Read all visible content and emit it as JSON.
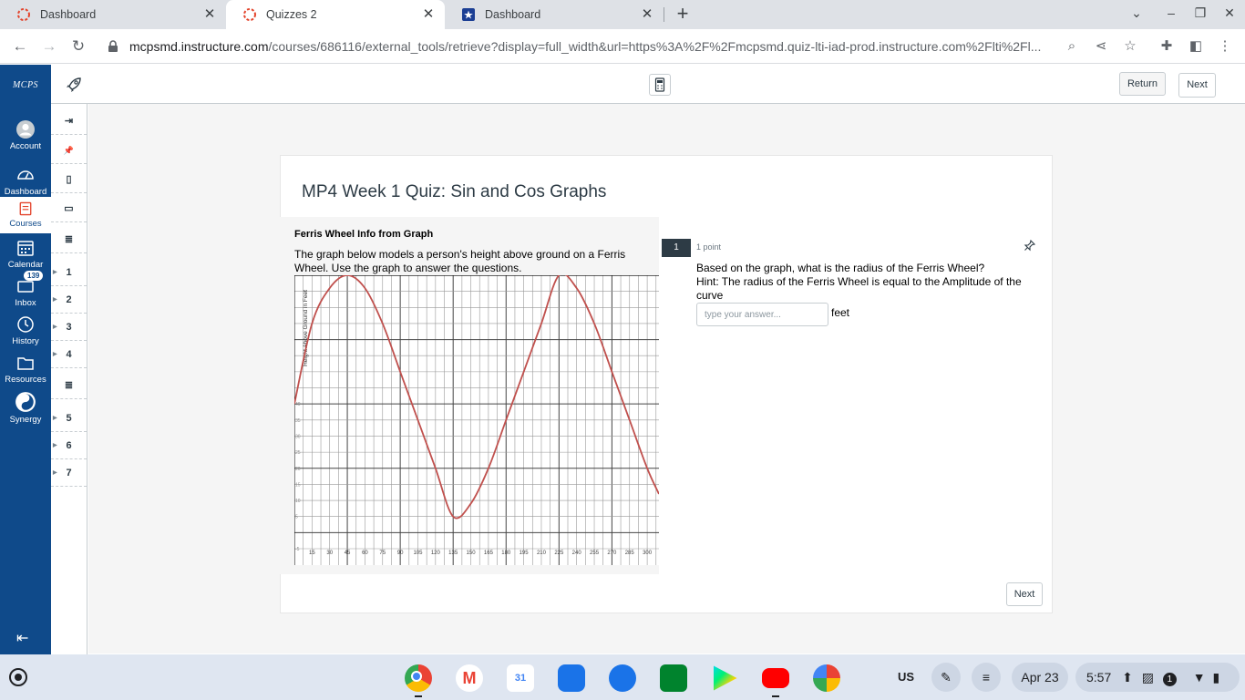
{
  "browser": {
    "tabs": [
      {
        "title": "Dashboard",
        "icon": "canvas-icon",
        "active": false
      },
      {
        "title": "Quizzes 2",
        "icon": "canvas-icon",
        "active": true
      },
      {
        "title": "Dashboard",
        "icon": "shield-icon",
        "active": false
      }
    ],
    "url_host": "mcpsmd.instructure.com",
    "url_path": "/courses/686116/external_tools/retrieve?display=full_width&url=https%3A%2F%2Fmcpsmd.quiz-lti-iad-prod.instructure.com%2Flti%2Fl..."
  },
  "global_nav": {
    "logo": "MCPS",
    "items": [
      {
        "label": "Account",
        "icon": "avatar-icon"
      },
      {
        "label": "Dashboard",
        "icon": "dashboard-icon"
      },
      {
        "label": "Courses",
        "icon": "book-icon"
      },
      {
        "label": "Calendar",
        "icon": "calendar-icon"
      },
      {
        "label": "Inbox",
        "icon": "inbox-icon",
        "badge": "139"
      },
      {
        "label": "History",
        "icon": "clock-icon"
      },
      {
        "label": "Resources",
        "icon": "folder-icon"
      },
      {
        "label": "Synergy",
        "icon": "synergy-icon"
      }
    ]
  },
  "topbar": {
    "return_label": "Return",
    "next_label": "Next"
  },
  "rail": {
    "items": [
      "1",
      "2",
      "3",
      "4",
      "5",
      "6",
      "7"
    ]
  },
  "quiz": {
    "title": "MP4 Week 1 Quiz: Sin and Cos Graphs",
    "stimulus_title": "Ferris Wheel Info from Graph",
    "stimulus_text": "The graph below models a person's height above ground on a Ferris Wheel. Use the graph to answer the questions.",
    "question_number": "1",
    "points": "1 point",
    "question_line1": "Based on the graph, what is the radius of the Ferris Wheel?",
    "question_line2": "Hint:  The radius of the Ferris Wheel is equal to the Amplitude of the curve",
    "answer_placeholder": "type your answer...",
    "answer_value": "",
    "unit": "feet",
    "next_label": "Next"
  },
  "chart_data": {
    "type": "line",
    "ylabel": "Height Above Ground in Feet",
    "x_ticks": [
      "15",
      "30",
      "45",
      "60",
      "75",
      "90",
      "105",
      "120",
      "135",
      "150",
      "165",
      "180",
      "195",
      "210",
      "225",
      "240",
      "255",
      "270",
      "285",
      "300"
    ],
    "y_ticks": [
      "40",
      "35",
      "30",
      "25",
      "20",
      "15",
      "10",
      "5",
      "-5"
    ],
    "xlim": [
      0,
      310
    ],
    "ylim": [
      -5,
      80
    ],
    "series": [
      {
        "color": "#c0504d",
        "x": [
          0,
          15,
          30,
          45,
          60,
          75,
          90,
          105,
          120,
          135,
          150,
          165,
          180,
          195,
          210,
          225,
          240,
          255,
          270,
          285,
          300,
          310
        ],
        "y": [
          40,
          65,
          76,
          80,
          76,
          65,
          50,
          35,
          20,
          5,
          9,
          20,
          35,
          50,
          65,
          80,
          76,
          65,
          50,
          35,
          20,
          12
        ]
      }
    ],
    "grid": true
  },
  "shelf": {
    "apps": [
      "chrome-icon",
      "gmail-icon",
      "calendar-icon",
      "files-icon",
      "chat-icon",
      "meet-icon",
      "play-store-icon",
      "youtube-icon",
      "photos-icon"
    ],
    "ime": "US",
    "date": "Apr 23",
    "time": "5:57",
    "notif_count": "1"
  }
}
